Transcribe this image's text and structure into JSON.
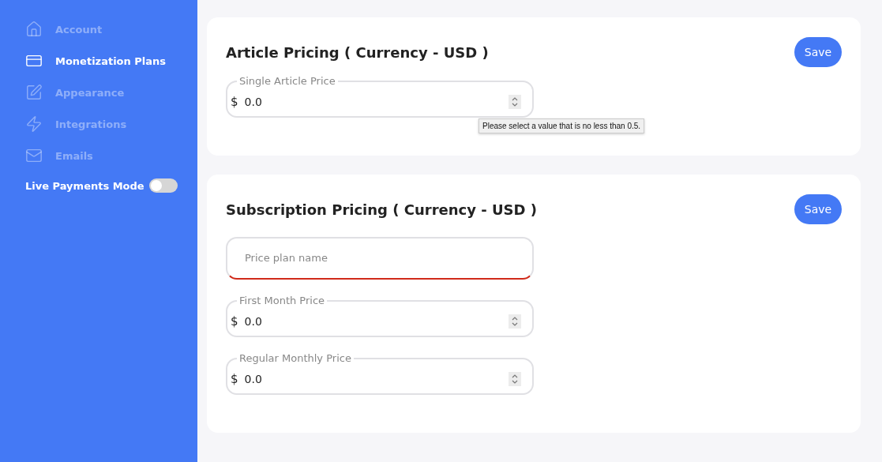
{
  "sidebar": {
    "items": [
      {
        "label": "Account",
        "selected": false
      },
      {
        "label": "Monetization Plans",
        "selected": true
      },
      {
        "label": "Appearance",
        "selected": false
      },
      {
        "label": "Integrations",
        "selected": false
      },
      {
        "label": "Emails",
        "selected": false
      }
    ],
    "live_mode": {
      "label": "Live Payments Mode",
      "on": false
    }
  },
  "sections": [
    {
      "title": "Article Pricing ( Currency - USD )",
      "button": "Save",
      "fields": [
        {
          "kind": "price",
          "label": "Single Article Price",
          "prefix": "$",
          "value": "0.0",
          "tooltip": "Please select a value that is no less than 0.5."
        }
      ]
    },
    {
      "title": "Subscription Pricing ( Currency - USD )",
      "button": "Save",
      "fields": [
        {
          "kind": "text",
          "placeholder": "Price plan name",
          "invalid": true
        },
        {
          "kind": "price",
          "label": "First Month Price",
          "prefix": "$",
          "value": "0.0"
        },
        {
          "kind": "price",
          "label": "Regular Monthly Price",
          "prefix": "$",
          "value": "0.0"
        }
      ]
    }
  ]
}
